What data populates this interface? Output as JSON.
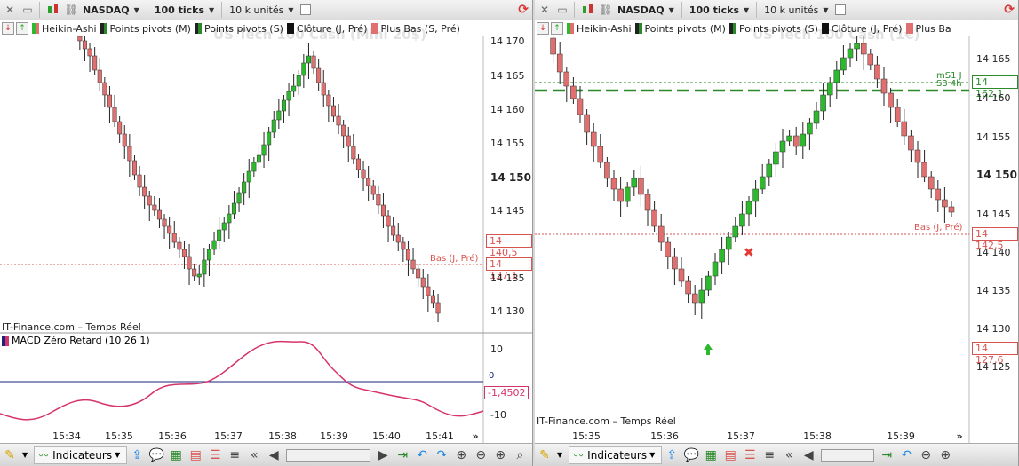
{
  "left": {
    "toolbar": {
      "symbol": "NASDAQ",
      "ticks": "100 ticks",
      "units": "10 k unités"
    },
    "indicators": [
      "Heikin-Ashi",
      "Points pivots (M)",
      "Points pivots (S)",
      "Clôture (J, Pré)",
      "Plus Bas (S, Pré)"
    ],
    "watermark": "US Tech 100 Cash (Mini 20$)",
    "price_axis": [
      "14 170",
      "14 165",
      "14 160",
      "14 155",
      "14 150",
      "14 145",
      "14 140,5",
      "14 137,1",
      "14 135",
      "14 130"
    ],
    "bas_label": "Bas (J, Pré)",
    "source": "IT-Finance.com – Temps Réel",
    "macd_label": "MACD Zéro Retard (10 26 1)",
    "macd_axis": [
      "10",
      "0",
      "-1,4502",
      "-10"
    ],
    "macd_tag": "-1,4502",
    "time_axis": [
      "15:34",
      "15:35",
      "15:36",
      "15:37",
      "15:38",
      "15:39",
      "15:40",
      "15:41"
    ],
    "indicators_button": "Indicateurs"
  },
  "right": {
    "toolbar": {
      "symbol": "NASDAQ",
      "ticks": "100 ticks",
      "units": "10 k unités"
    },
    "indicators": [
      "Heikin-Ashi",
      "Points pivots (M)",
      "Points pivots (S)",
      "Clôture (J, Pré)",
      "Plus Ba"
    ],
    "watermark": "US Tech 100 Cash (1€)",
    "price_axis": [
      "14 165",
      "14 162,1",
      "14 160",
      "14 155",
      "14 150",
      "14 145",
      "14 142,5",
      "14 140",
      "14 135",
      "14 130",
      "14 127,6",
      "14 125"
    ],
    "ms1_label": "mS1 J",
    "s3_label": "S3 4h",
    "bas_label": "Bas (J, Pré)",
    "source": "IT-Finance.com – Temps Réel",
    "time_axis": [
      "15:35",
      "15:36",
      "15:37",
      "15:38",
      "15:39"
    ],
    "indicators_button": "Indicateurs"
  },
  "colors": {
    "up": "#2eb82e",
    "down": "#e07070",
    "bas": "#d9534f",
    "pivot": "#2a8a2a",
    "macd": "#d6336c"
  }
}
